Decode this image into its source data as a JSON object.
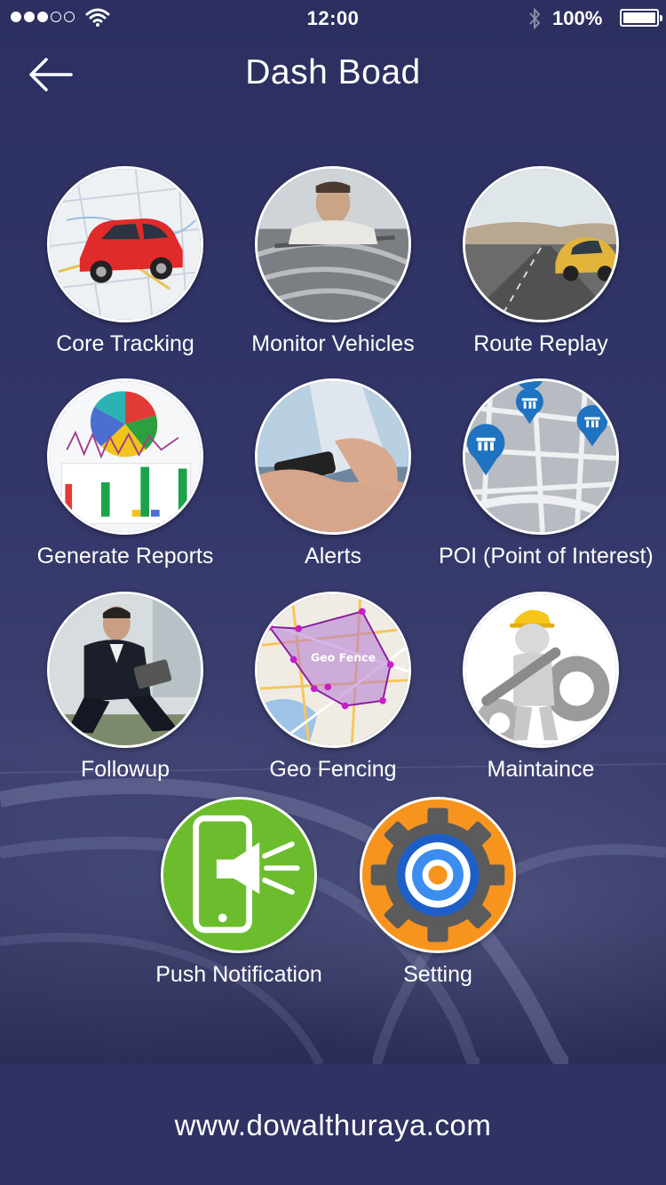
{
  "status": {
    "time": "12:00",
    "battery": "100%"
  },
  "header": {
    "title": "Dash Boad"
  },
  "tiles": [
    {
      "label": "Core Tracking"
    },
    {
      "label": "Monitor Vehicles"
    },
    {
      "label": "Route Replay"
    },
    {
      "label": "Generate Reports"
    },
    {
      "label": "Alerts"
    },
    {
      "label": "POI (Point of Interest)"
    },
    {
      "label": "Followup"
    },
    {
      "label": "Geo Fencing"
    },
    {
      "label": "Maintaince"
    },
    {
      "label": "Push Notification"
    },
    {
      "label": "Setting"
    }
  ],
  "geo_fence_map_label": "Geo Fence",
  "footer": {
    "url": "www.dowalthuraya.com"
  },
  "colors": {
    "background": "#2f3263",
    "push_green": "#6cbd2d",
    "setting_orange": "#f7941d"
  }
}
